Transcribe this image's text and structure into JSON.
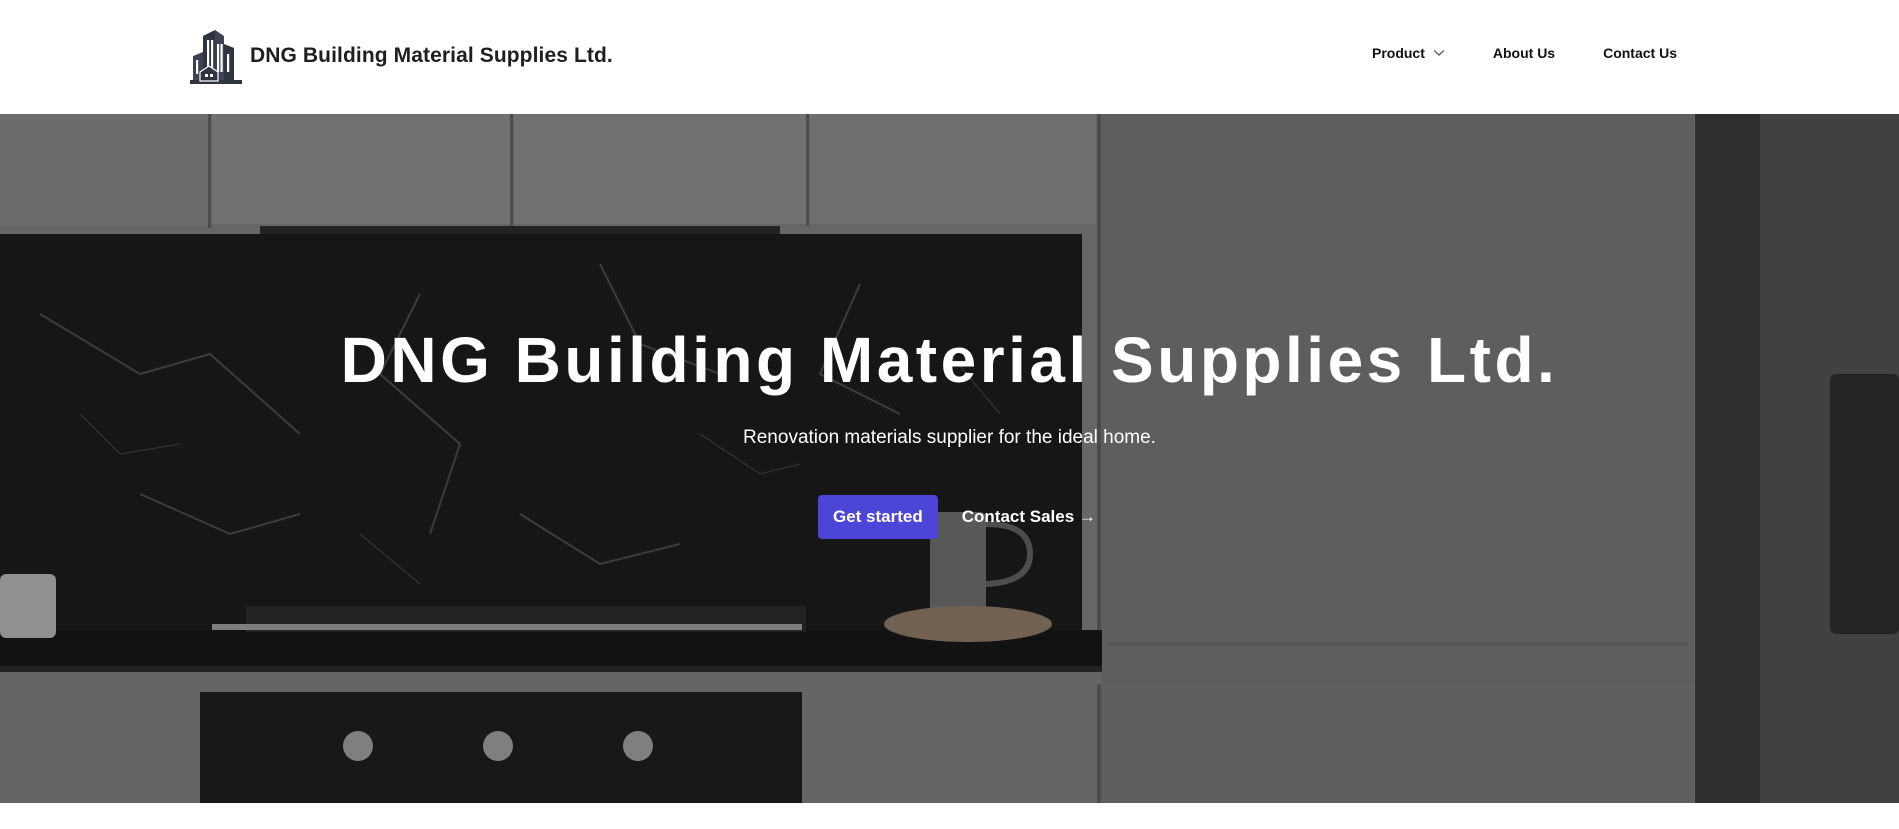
{
  "header": {
    "brand_name": "DNG Building Material Supplies Ltd.",
    "logo_icon": "buildings-logo-icon",
    "nav": [
      {
        "label": "Product",
        "has_dropdown": true,
        "icon": "chevron-down-icon"
      },
      {
        "label": "About Us"
      },
      {
        "label": "Contact Us"
      }
    ]
  },
  "hero": {
    "title": "DNG Building Material Supplies Ltd.",
    "subtitle": "Renovation materials supplier for the ideal home.",
    "primary_cta": "Get started",
    "secondary_cta": "Contact Sales →",
    "background_image": "kitchen-interior-image"
  },
  "colors": {
    "accent": "#4c45d8",
    "header_bg": "#ffffff",
    "text_dark": "#1f1f1f"
  }
}
